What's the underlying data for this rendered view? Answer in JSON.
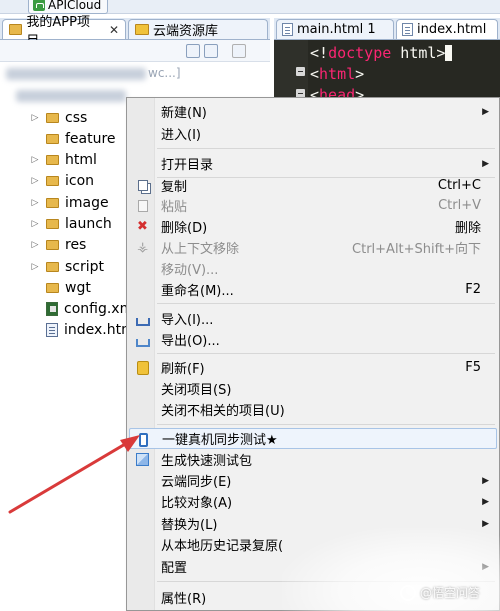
{
  "window": {
    "app_tab": "APICloud"
  },
  "views": {
    "tabs": [
      {
        "label": "我的APP项目",
        "close": "✕"
      },
      {
        "label": "云端资源库"
      }
    ]
  },
  "editor": {
    "tabs": [
      {
        "label": "main.html 1"
      },
      {
        "label": "index.html"
      }
    ],
    "lines": [
      {
        "open": "<!",
        "keyword": "doctype",
        "rest": " html>"
      },
      {
        "open": "<",
        "keyword": "html",
        "rest": ">"
      },
      {
        "open": "<",
        "keyword": "head",
        "rest": ">"
      }
    ]
  },
  "tree": {
    "project_suffix": "wc...]",
    "items": [
      {
        "label": "css",
        "type": "folder",
        "expandable": true
      },
      {
        "label": "feature",
        "type": "folder",
        "expandable": false
      },
      {
        "label": "html",
        "type": "folder",
        "expandable": true
      },
      {
        "label": "icon",
        "type": "folder",
        "expandable": true
      },
      {
        "label": "image",
        "type": "folder",
        "expandable": true
      },
      {
        "label": "launch",
        "type": "folder",
        "expandable": true
      },
      {
        "label": "res",
        "type": "folder",
        "expandable": true
      },
      {
        "label": "script",
        "type": "folder",
        "expandable": true
      },
      {
        "label": "wgt",
        "type": "folder",
        "expandable": false
      },
      {
        "label": "config.xm",
        "type": "xml",
        "expandable": false
      },
      {
        "label": "index.htm",
        "type": "html",
        "expandable": false
      }
    ]
  },
  "context_menu": {
    "items": [
      {
        "label": "新建(N)",
        "shortcut": "",
        "submenu": true,
        "disabled": false,
        "icon": ""
      },
      {
        "label": "进入(I)",
        "shortcut": "",
        "submenu": false,
        "disabled": false,
        "icon": ""
      },
      {
        "label": "打开目录",
        "shortcut": "",
        "submenu": true,
        "disabled": false,
        "icon": ""
      },
      {
        "label": "复制",
        "shortcut": "Ctrl+C",
        "submenu": false,
        "disabled": false,
        "icon": "copy-icon"
      },
      {
        "label": "粘贴",
        "shortcut": "Ctrl+V",
        "submenu": false,
        "disabled": true,
        "icon": "paste-icon"
      },
      {
        "label": "删除(D)",
        "shortcut": "删除",
        "submenu": false,
        "disabled": false,
        "icon": "delete-icon"
      },
      {
        "label": "从上下文移除",
        "shortcut": "Ctrl+Alt+Shift+向下",
        "submenu": false,
        "disabled": true,
        "icon": "remove-context-icon"
      },
      {
        "label": "移动(V)...",
        "shortcut": "",
        "submenu": false,
        "disabled": true,
        "icon": ""
      },
      {
        "label": "重命名(M)...",
        "shortcut": "F2",
        "submenu": false,
        "disabled": false,
        "icon": ""
      },
      {
        "label": "导入(I)...",
        "shortcut": "",
        "submenu": false,
        "disabled": false,
        "icon": "import-icon"
      },
      {
        "label": "导出(O)...",
        "shortcut": "",
        "submenu": false,
        "disabled": false,
        "icon": "export-icon"
      },
      {
        "label": "刷新(F)",
        "shortcut": "F5",
        "submenu": false,
        "disabled": false,
        "icon": "refresh-icon"
      },
      {
        "label": "关闭项目(S)",
        "shortcut": "",
        "submenu": false,
        "disabled": false,
        "icon": ""
      },
      {
        "label": "关闭不相关的项目(U)",
        "shortcut": "",
        "submenu": false,
        "disabled": false,
        "icon": ""
      },
      {
        "label": "一键真机同步测试★",
        "shortcut": "",
        "submenu": false,
        "disabled": false,
        "icon": "phone-icon",
        "highlighted": true
      },
      {
        "label": "生成快速测试包",
        "shortcut": "",
        "submenu": false,
        "disabled": false,
        "icon": "package-icon"
      },
      {
        "label": "云端同步(E)",
        "shortcut": "",
        "submenu": true,
        "disabled": false,
        "icon": ""
      },
      {
        "label": "比较对象(A)",
        "shortcut": "",
        "submenu": true,
        "disabled": false,
        "icon": ""
      },
      {
        "label": "替换为(L)",
        "shortcut": "",
        "submenu": true,
        "disabled": false,
        "icon": ""
      },
      {
        "label": "从本地历史记录复原(",
        "shortcut": "",
        "submenu": false,
        "disabled": false,
        "icon": ""
      },
      {
        "label": "配置",
        "shortcut": "",
        "submenu": true,
        "disabled": false,
        "icon": ""
      },
      {
        "label": "属性(R)",
        "shortcut": "",
        "submenu": false,
        "disabled": false,
        "icon": ""
      }
    ]
  },
  "watermark": {
    "text": "@悟空问答"
  },
  "colors": {
    "accent": "#3d6bb4",
    "arrow": "#d93a3a",
    "editor_bg": "#272822",
    "keyword": "#f92672"
  }
}
